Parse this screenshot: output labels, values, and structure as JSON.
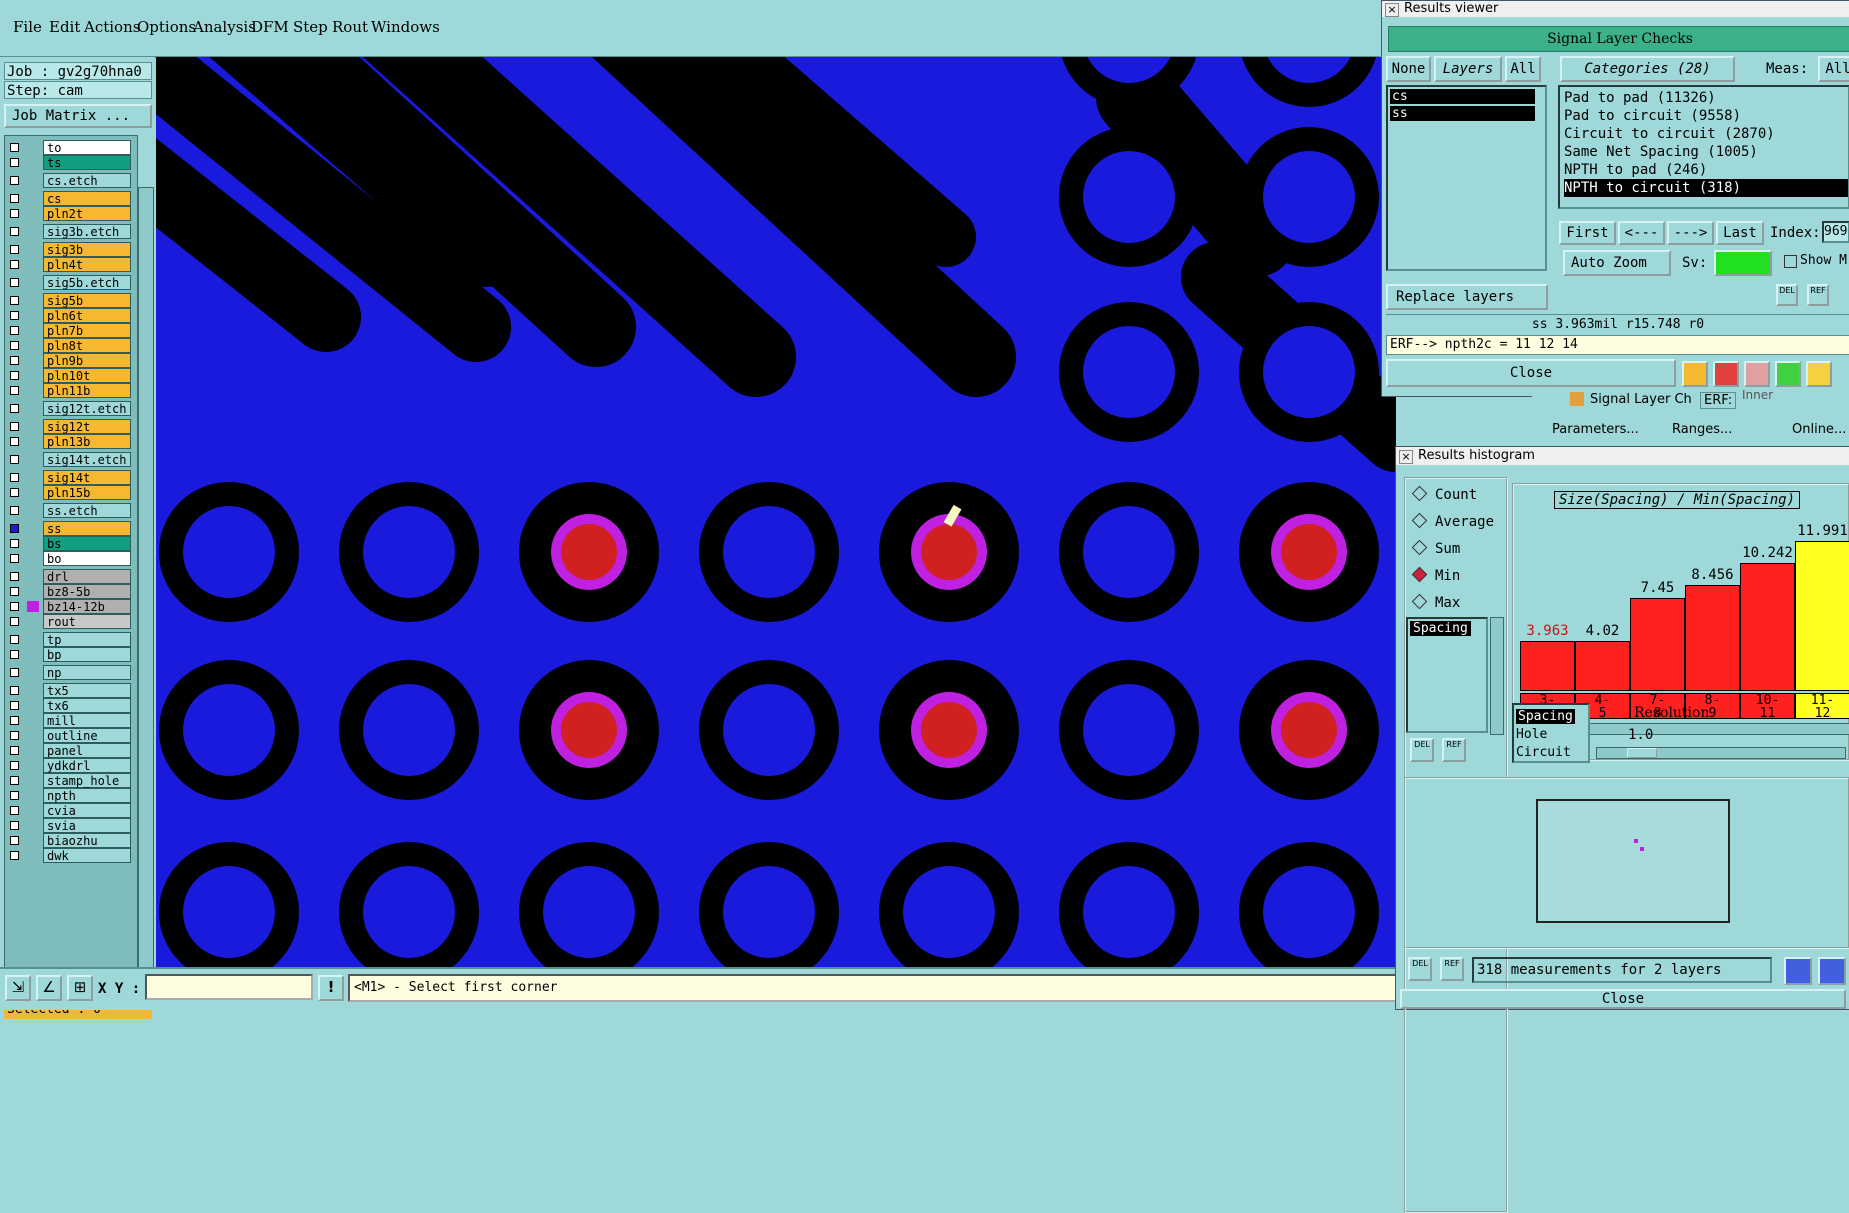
{
  "menu": [
    "File",
    "Edit",
    "Actions",
    "Options",
    "Analysis",
    "DFM",
    "Step",
    "Rout",
    "Windows"
  ],
  "job": {
    "job_label": "Job : gv2g70hna0",
    "step_label": "Step: cam",
    "matrix_button": "Job Matrix ..."
  },
  "layers": [
    {
      "name": "to",
      "color": "#ffffff"
    },
    {
      "name": "ts",
      "color": "#10a080"
    },
    {
      "name": "cs.etch",
      "color": "#9ed8d8"
    },
    {
      "name": "cs",
      "color": "#f5b830"
    },
    {
      "name": "pln2t",
      "color": "#f5b830"
    },
    {
      "name": "sig3b.etch",
      "color": "#9ed8d8"
    },
    {
      "name": "sig3b",
      "color": "#f5b830"
    },
    {
      "name": "pln4t",
      "color": "#f5b830"
    },
    {
      "name": "sig5b.etch",
      "color": "#9ed8d8"
    },
    {
      "name": "sig5b",
      "color": "#f5b830"
    },
    {
      "name": "pln6t",
      "color": "#f5b830"
    },
    {
      "name": "pln7b",
      "color": "#f5b830"
    },
    {
      "name": "pln8t",
      "color": "#f5b830"
    },
    {
      "name": "pln9b",
      "color": "#f5b830"
    },
    {
      "name": "pln10t",
      "color": "#f5b830"
    },
    {
      "name": "pln11b",
      "color": "#f5b830"
    },
    {
      "name": "sig12t.etch",
      "color": "#9ed8d8"
    },
    {
      "name": "sig12t",
      "color": "#f5b830"
    },
    {
      "name": "pln13b",
      "color": "#f5b830"
    },
    {
      "name": "sig14t.etch",
      "color": "#9ed8d8"
    },
    {
      "name": "sig14t",
      "color": "#f5b830"
    },
    {
      "name": "pln15b",
      "color": "#f5b830"
    },
    {
      "name": "ss.etch",
      "color": "#9ed8d8"
    },
    {
      "name": "ss",
      "color": "#f5b830"
    },
    {
      "name": "bs",
      "color": "#10a080"
    },
    {
      "name": "bo",
      "color": "#ffffff"
    },
    {
      "name": "drl",
      "color": "#b0b0b0"
    },
    {
      "name": "bz8-5b",
      "color": "#b0b0b0"
    },
    {
      "name": "bz14-12b",
      "color": "#b0b0b0"
    },
    {
      "name": "rout",
      "color": "#c8c8c8"
    },
    {
      "name": "tp",
      "color": "#9ed8d8"
    },
    {
      "name": "bp",
      "color": "#9ed8d8"
    },
    {
      "name": "np",
      "color": "#9ed8d8"
    },
    {
      "name": "tx5",
      "color": "#9ed8d8"
    },
    {
      "name": "tx6",
      "color": "#9ed8d8"
    },
    {
      "name": "mill",
      "color": "#9ed8d8"
    },
    {
      "name": "outline",
      "color": "#9ed8d8"
    },
    {
      "name": "panel",
      "color": "#9ed8d8"
    },
    {
      "name": "ydkdrl",
      "color": "#9ed8d8"
    },
    {
      "name": "stamp_hole",
      "color": "#9ed8d8"
    },
    {
      "name": "npth",
      "color": "#9ed8d8"
    },
    {
      "name": "cvia",
      "color": "#9ed8d8"
    },
    {
      "name": "svia",
      "color": "#9ed8d8"
    },
    {
      "name": "biaozhu",
      "color": "#9ed8d8"
    },
    {
      "name": "dwk",
      "color": "#9ed8d8"
    }
  ],
  "selected_label": "Selected : 0",
  "bottom": {
    "xy_label": "X Y :",
    "xy_value": "",
    "prompt": "<M1> - Select first corner"
  },
  "results_viewer": {
    "title": "Results viewer",
    "header": "Signal Layer Checks",
    "btn_none": "None",
    "btn_layers": "Layers",
    "btn_all": "All",
    "categories_label": "Categories (28)",
    "meas_label": "Meas:",
    "meas_value": "All",
    "layer_items": [
      "cs",
      "ss"
    ],
    "categories": [
      "Pad to pad (11326)",
      "Pad to circuit (9558)",
      "Circuit to circuit (2870)",
      "Same Net Spacing (1005)",
      "NPTH to pad (246)",
      "NPTH to circuit (318)"
    ],
    "nav": {
      "first": "First",
      "prev": "<---",
      "next": "--->",
      "last": "Last",
      "index_label": "Index:",
      "index_value": "969"
    },
    "auto_zoom": "Auto Zoom",
    "sv_label": "Sv:",
    "show_label": "Show M",
    "replace_layers": "Replace layers",
    "status": "ss 3.963mil  r15.748  r0",
    "erf": "ERF--> npth2c = 11 12 14",
    "close": "Close"
  },
  "behind": {
    "signal_layer": "Signal Layer Ch",
    "erf": "ERF:",
    "erf_value": "Inner",
    "parameters": "Parameters...",
    "ranges": "Ranges...",
    "online": "Online..."
  },
  "histogram": {
    "title": "Results histogram",
    "modes": [
      "Count",
      "Average",
      "Sum",
      "Min",
      "Max"
    ],
    "selected_mode": "Min",
    "list_item": "Spacing",
    "chart_title": "Size(Spacing) / Min(Spacing)",
    "tabs": [
      "Spacing",
      "Hole",
      "Circuit"
    ],
    "resolution_label": "Resolution",
    "resolution_value": "1.0",
    "footer": "318 measurements for 2 layers",
    "close": "Close"
  },
  "chart_data": {
    "type": "bar",
    "title": "Size(Spacing) / Min(Spacing)",
    "categories": [
      "3-4",
      "4-5",
      "7-8",
      "8-9",
      "10-11",
      "11-12"
    ],
    "values": [
      3.963,
      4.02,
      7.45,
      8.456,
      10.242,
      11.991
    ],
    "colors": [
      "#ff2020",
      "#ff2020",
      "#ff2020",
      "#ff2020",
      "#ff2020",
      "#ffff20"
    ],
    "ylim": [
      0,
      11.991
    ]
  },
  "colors": {
    "board": "#1a1adc",
    "copper": "#000000",
    "pad_highlight": "#c020e0",
    "pad_fill": "#d02020",
    "panel": "#9ed8d8"
  }
}
